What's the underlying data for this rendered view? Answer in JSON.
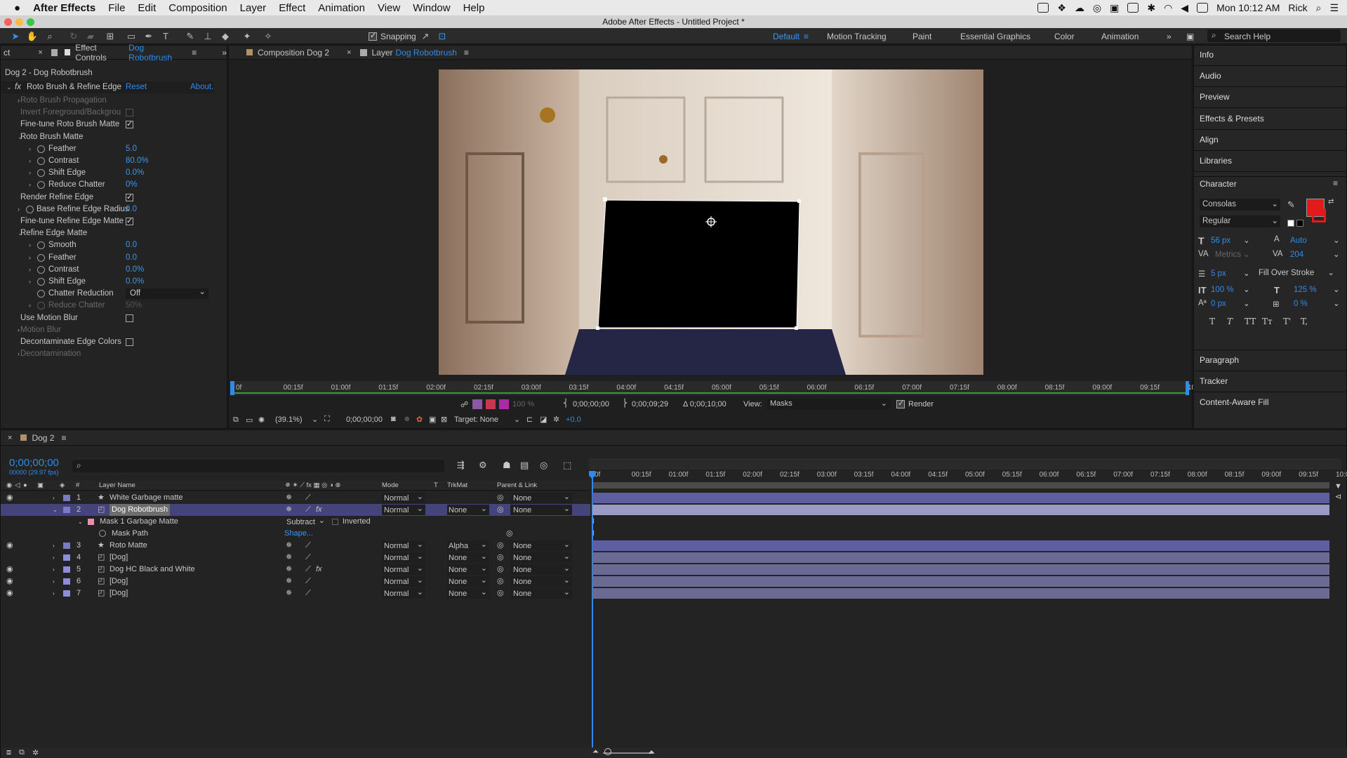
{
  "menubar": {
    "app": "After Effects",
    "items": [
      "File",
      "Edit",
      "Composition",
      "Layer",
      "Effect",
      "Animation",
      "View",
      "Window",
      "Help"
    ],
    "time": "Mon 10:12 AM",
    "user": "Rick"
  },
  "title": "Adobe After Effects - Untitled Project *",
  "toolbar": {
    "snapping": "Snapping",
    "workspaces": [
      "Default",
      "Motion Tracking",
      "Paint",
      "Essential Graphics",
      "Color",
      "Animation"
    ],
    "search": "Search Help"
  },
  "effect_controls": {
    "tab_prefix": "Effect Controls",
    "tab_layer": "Dog Robotbrush",
    "truncated_tab": "ct",
    "subtitle": "Dog 2 - Dog Robotbrush",
    "effect_name": "Roto Brush & Refine Edge",
    "reset": "Reset",
    "about": "About.",
    "rows": [
      {
        "label": "Roto Brush Propagation",
        "dim": true
      },
      {
        "label": "Invert Foreground/Backgrou",
        "dim": true
      },
      {
        "label": "Fine-tune Roto Brush Matte"
      },
      {
        "label": "Roto Brush Matte"
      },
      {
        "label": "Feather",
        "value": "5.0"
      },
      {
        "label": "Contrast",
        "value": "80.0%"
      },
      {
        "label": "Shift Edge",
        "value": "0.0%"
      },
      {
        "label": "Reduce Chatter",
        "value": "0%"
      },
      {
        "label": "Render Refine Edge"
      },
      {
        "label": "Base Refine Edge Radius",
        "value": "0.0"
      },
      {
        "label": "Fine-tune Refine Edge Matte"
      },
      {
        "label": "Refine Edge Matte"
      },
      {
        "label": "Smooth",
        "value": "0.0"
      },
      {
        "label": "Feather",
        "value": "0.0"
      },
      {
        "label": "Contrast",
        "value": "0.0%"
      },
      {
        "label": "Shift Edge",
        "value": "0.0%"
      },
      {
        "label": "Chatter Reduction",
        "value": "Off"
      },
      {
        "label": "Reduce Chatter",
        "value": "50%",
        "dim": true
      },
      {
        "label": "Use Motion Blur"
      },
      {
        "label": "Motion Blur",
        "dim": true
      },
      {
        "label": "Decontaminate Edge Colors"
      },
      {
        "label": "Decontamination",
        "dim": true
      }
    ]
  },
  "viewer": {
    "tab1": "Composition Dog 2",
    "tab2_prefix": "Layer",
    "tab2_name": "Dog Robotbrush",
    "ruler": [
      "0f",
      "00:15f",
      "01:00f",
      "01:15f",
      "02:00f",
      "02:15f",
      "03:00f",
      "03:15f",
      "04:00f",
      "04:15f",
      "05:00f",
      "05:15f",
      "06:00f",
      "06:15f",
      "07:00f",
      "07:15f",
      "08:00f",
      "08:15f",
      "09:00f",
      "09:15f",
      "10:0"
    ],
    "controls": {
      "opacity": "100 %",
      "in": "0;00;00;00",
      "out": "0;00;09;29",
      "duration": "Δ 0;00;10;00",
      "view_label": "View:",
      "view_value": "Masks",
      "render": "Render"
    },
    "footer": {
      "zoom": "(39.1%)",
      "time": "0;00;00;00",
      "target": "Target: None",
      "offset": "+0.0"
    }
  },
  "right_panel": {
    "items_top": [
      "Info",
      "Audio",
      "Preview",
      "Effects & Presets",
      "Align",
      "Libraries"
    ],
    "character": "Character",
    "font": "Consolas",
    "style": "Regular",
    "size": "56 px",
    "leading": "Auto",
    "kerning": "Metrics",
    "tracking": "204",
    "stroke": "5 px",
    "stroke_type": "Fill Over Stroke",
    "vscale": "100 %",
    "hscale": "125 %",
    "baseline": "0 px",
    "tsume": "0 %",
    "styles": [
      "T",
      "T",
      "TT",
      "Tт",
      "T'",
      "T,"
    ],
    "items_bottom": [
      "Paragraph",
      "Tracker",
      "Content-Aware Fill"
    ],
    "fill_color": "#e21a1a"
  },
  "timeline": {
    "comp": "Dog 2",
    "time": "0;00;00;00",
    "fps": "00000 (29.97 fps)",
    "headers": {
      "num": "#",
      "name": "Layer Name",
      "mode": "Mode",
      "t": "T",
      "trkmat": "TrkMat",
      "parent": "Parent & Link"
    },
    "ruler": [
      "0f",
      "00:15f",
      "01:00f",
      "01:15f",
      "02:00f",
      "02:15f",
      "03:00f",
      "03:15f",
      "04:00f",
      "04:15f",
      "05:00f",
      "05:15f",
      "06:00f",
      "06:15f",
      "07:00f",
      "07:15f",
      "08:00f",
      "08:15f",
      "09:00f",
      "09:15f",
      "10:0"
    ],
    "layers": [
      {
        "num": "1",
        "name": "White Garbage matte",
        "mode": "Normal",
        "trkmat": "",
        "parent": "None",
        "eye": true
      },
      {
        "num": "2",
        "name": "Dog Robotbrush",
        "mode": "Normal",
        "trkmat": "None",
        "parent": "None",
        "eye": false,
        "selected": true
      },
      {
        "num": "3",
        "name": "Roto Matte",
        "mode": "Normal",
        "trkmat": "Alpha",
        "parent": "None",
        "eye": true
      },
      {
        "num": "4",
        "name": "[Dog]",
        "mode": "Normal",
        "trkmat": "None",
        "parent": "None",
        "eye": false
      },
      {
        "num": "5",
        "name": "Dog HC Black and White",
        "mode": "Normal",
        "trkmat": "None",
        "parent": "None",
        "eye": true
      },
      {
        "num": "6",
        "name": "[Dog]",
        "mode": "Normal",
        "trkmat": "None",
        "parent": "None",
        "eye": true
      },
      {
        "num": "7",
        "name": "[Dog]",
        "mode": "Normal",
        "trkmat": "None",
        "parent": "None",
        "eye": true
      }
    ],
    "mask": {
      "name": "Mask 1 Garbage Matte",
      "mode": "Subtract",
      "inverted": "Inverted",
      "path_label": "Mask Path",
      "path_value": "Shape..."
    }
  }
}
